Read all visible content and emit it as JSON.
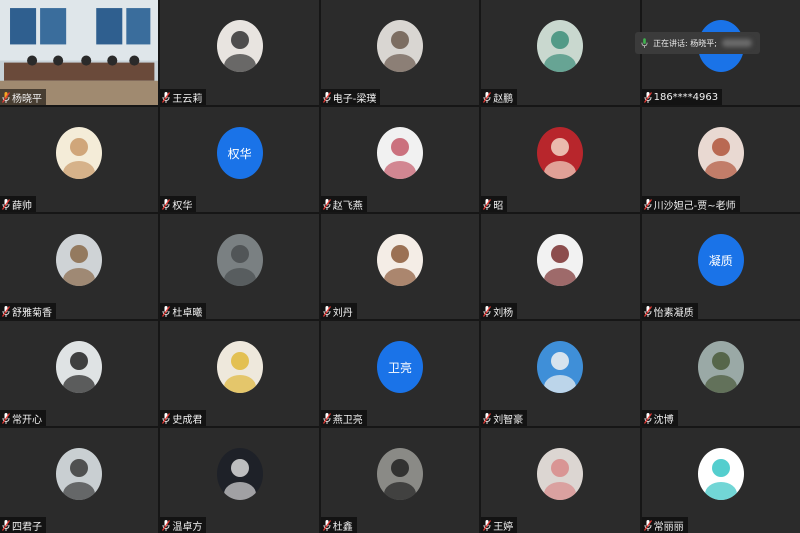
{
  "speaking_indicator": {
    "label": "正在讲话: 杨晓平;"
  },
  "participants": [
    {
      "name": "杨晓平",
      "type": "video",
      "active": true,
      "mic_color": "#f5a623"
    },
    {
      "name": "王云莉",
      "type": "photo",
      "avatar_icon": "anime-girl-avatar",
      "bg": "#e8e4e0",
      "fg": "#333333"
    },
    {
      "name": "电子-梁璞",
      "type": "photo",
      "avatar_icon": "child-portrait-avatar",
      "bg": "#d9d6d2",
      "fg": "#6b5a4e"
    },
    {
      "name": "赵鹏",
      "type": "photo",
      "avatar_icon": "green-illustration-avatar",
      "bg": "#c9d8cf",
      "fg": "#3d8f7a"
    },
    {
      "name": "186****4963",
      "type": "text",
      "avatar_text": "",
      "avatar_icon": "blank-avatar"
    },
    {
      "name": "薛帅",
      "type": "photo",
      "avatar_icon": "cartoon-pig-avatar",
      "bg": "#f4ecd8",
      "fg": "#c99a6a"
    },
    {
      "name": "权华",
      "type": "text",
      "avatar_text": "权华"
    },
    {
      "name": "赵飞燕",
      "type": "photo",
      "avatar_icon": "family-cartoon-avatar",
      "bg": "#f1f1f1",
      "fg": "#c45a6a"
    },
    {
      "name": "昭",
      "type": "photo",
      "avatar_icon": "red-couple-avatar",
      "bg": "#b8262c",
      "fg": "#f2d5c4"
    },
    {
      "name": "川沙妲己-贾~老师",
      "type": "photo",
      "avatar_icon": "woman-portrait-avatar",
      "bg": "#e9d9d2",
      "fg": "#b0553c"
    },
    {
      "name": "舒雅菊香",
      "type": "photo",
      "avatar_icon": "beach-dancer-avatar",
      "bg": "#cfd3d6",
      "fg": "#8a6a4a"
    },
    {
      "name": "杜卓曦",
      "type": "photo",
      "avatar_icon": "gray-landscape-avatar",
      "bg": "#7a8082",
      "fg": "#4a4e50"
    },
    {
      "name": "刘丹",
      "type": "photo",
      "avatar_icon": "cartoon-girl-avatar",
      "bg": "#f4ede6",
      "fg": "#8b5a3a"
    },
    {
      "name": "刘杨",
      "type": "photo",
      "avatar_icon": "cartoon-group-avatar",
      "bg": "#f2f2f2",
      "fg": "#7a3030"
    },
    {
      "name": "怡素凝质",
      "type": "text",
      "avatar_text": "凝质"
    },
    {
      "name": "常开心",
      "type": "photo",
      "avatar_icon": "jumping-person-avatar",
      "bg": "#dfe3e4",
      "fg": "#222222"
    },
    {
      "name": "史成君",
      "type": "photo",
      "avatar_icon": "cartoon-pineapple-avatar",
      "bg": "#eee8dc",
      "fg": "#e0b83a"
    },
    {
      "name": "燕卫亮",
      "type": "text",
      "avatar_text": "卫亮"
    },
    {
      "name": "刘智豪",
      "type": "photo",
      "avatar_icon": "chimney-sky-avatar",
      "bg": "#3f8fd8",
      "fg": "#f2f2f2"
    },
    {
      "name": "沈博",
      "type": "photo",
      "avatar_icon": "great-wall-avatar",
      "bg": "#9aa9a6",
      "fg": "#4a5a3a"
    },
    {
      "name": "四君子",
      "type": "photo",
      "avatar_icon": "sculpture-avatar",
      "bg": "#c9cfd2",
      "fg": "#3a3a3a"
    },
    {
      "name": "温卓方",
      "type": "photo",
      "avatar_icon": "dark-photo-avatar",
      "bg": "#1e2128",
      "fg": "#d9d9d9"
    },
    {
      "name": "杜鑫",
      "type": "photo",
      "avatar_icon": "sunset-silhouette-avatar",
      "bg": "#8a8a86",
      "fg": "#222222"
    },
    {
      "name": "王婷",
      "type": "photo",
      "avatar_icon": "toy-figure-avatar",
      "bg": "#dcd6d2",
      "fg": "#d88a8a"
    },
    {
      "name": "常丽丽",
      "type": "photo",
      "avatar_icon": "teal-drop-avatar",
      "bg": "#ffffff",
      "fg": "#36c5c5"
    }
  ]
}
